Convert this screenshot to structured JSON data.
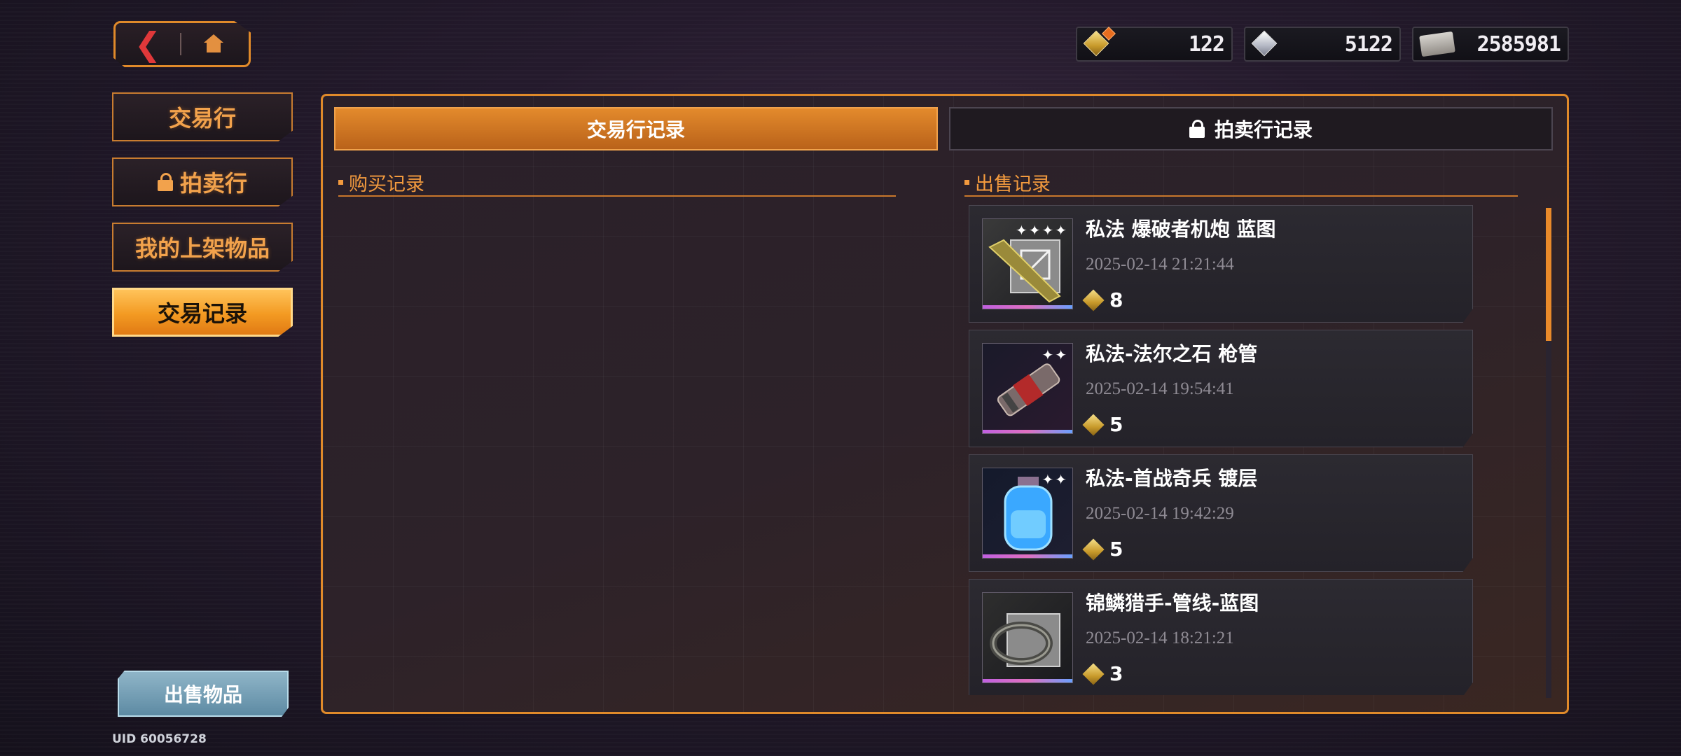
{
  "nav": {
    "back_icon": "chevron-left-icon",
    "home_icon": "home-icon"
  },
  "currencies": [
    {
      "icon": "gold-gem-icon",
      "value": "122"
    },
    {
      "icon": "silver-gem-icon",
      "value": "5122"
    },
    {
      "icon": "ticket-icon",
      "value": "2585981"
    }
  ],
  "sidebar": {
    "items": [
      {
        "label": "交易行",
        "locked": false
      },
      {
        "label": "拍卖行",
        "locked": true
      },
      {
        "label": "我的上架物品",
        "locked": false
      },
      {
        "label": "交易记录",
        "locked": false,
        "active": true
      }
    ],
    "sell_button": "出售物品",
    "uid": "UID 60056728"
  },
  "tabs": [
    {
      "label": "交易行记录",
      "active": true
    },
    {
      "label": "拍卖行记录",
      "active": false,
      "locked": true
    }
  ],
  "purchase": {
    "title": "购买记录",
    "items": []
  },
  "sales": {
    "title": "出售记录",
    "items": [
      {
        "name": "私法 爆破者机炮 蓝图",
        "time": "2025-02-14 21:21:44",
        "price": "8",
        "stars": "✦✦✦✦",
        "icon": "cannon-blueprint-icon"
      },
      {
        "name": "私法-法尔之石 枪管",
        "time": "2025-02-14 19:54:41",
        "price": "5",
        "stars": "✦✦",
        "icon": "gun-barrel-icon"
      },
      {
        "name": "私法-首战奇兵 镀层",
        "time": "2025-02-14 19:42:29",
        "price": "5",
        "stars": "✦✦",
        "icon": "plating-canister-icon"
      },
      {
        "name": "锦鳞猎手-管线-蓝图",
        "time": "2025-02-14 18:21:21",
        "price": "3",
        "stars": "",
        "icon": "cable-blueprint-icon"
      }
    ]
  },
  "colors": {
    "accent": "#e08a2a",
    "active_menu": "#f39a22",
    "rarity_bar": "#c060e0"
  }
}
